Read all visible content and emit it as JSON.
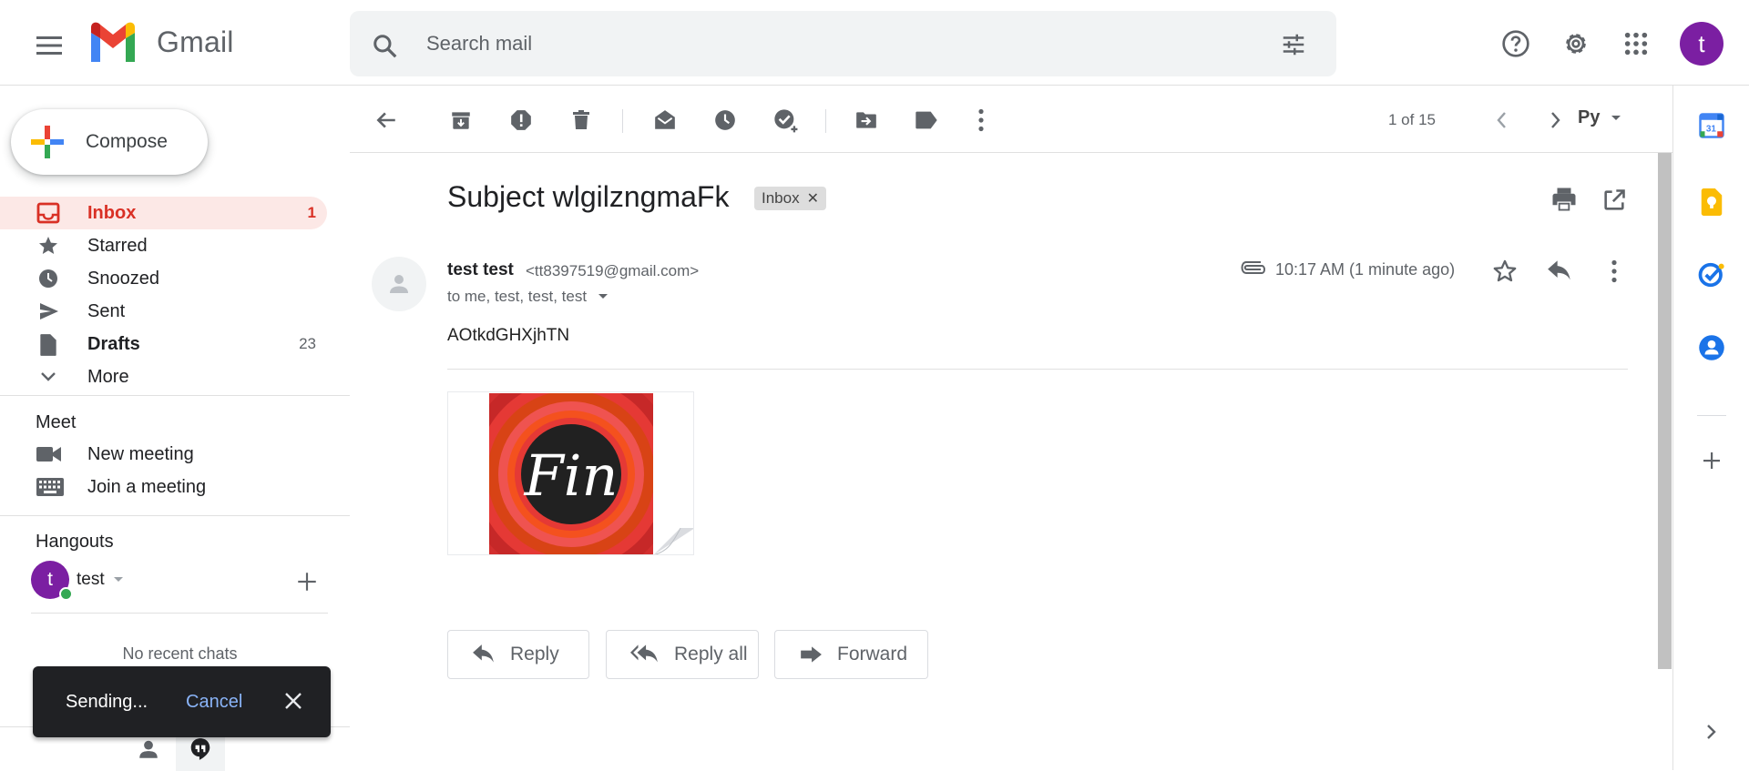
{
  "app": {
    "name": "Gmail"
  },
  "search": {
    "placeholder": "Search mail"
  },
  "account": {
    "initial": "t"
  },
  "compose": {
    "label": "Compose"
  },
  "nav": {
    "items": [
      {
        "label": "Inbox",
        "count": "1"
      },
      {
        "label": "Starred",
        "count": ""
      },
      {
        "label": "Snoozed",
        "count": ""
      },
      {
        "label": "Sent",
        "count": ""
      },
      {
        "label": "Drafts",
        "count": "23"
      },
      {
        "label": "More",
        "count": ""
      }
    ]
  },
  "meet": {
    "title": "Meet",
    "new_meeting": "New meeting",
    "join_meeting": "Join a meeting"
  },
  "hangouts": {
    "title": "Hangouts",
    "user_initial": "t",
    "user_name": "test",
    "empty": "No recent chats"
  },
  "toast": {
    "text": "Sending...",
    "action": "Cancel"
  },
  "toolbar": {
    "pager": "1 of 15",
    "language": "Py"
  },
  "email": {
    "subject": "Subject wlgilzngmaFk",
    "label": "Inbox",
    "sender_name": "test test",
    "sender_email": "<tt8397519@gmail.com>",
    "recipients": "to me, test, test, test",
    "timestamp": "10:17 AM (1 minute ago)",
    "body": "AOtkdGHXjhTN",
    "attachment_text": "Fin"
  },
  "reply_buttons": {
    "reply": "Reply",
    "reply_all": "Reply all",
    "forward": "Forward"
  },
  "colors": {
    "accent_red": "#d93025",
    "avatar_purple": "#7b1fa2",
    "active_bg": "#fce8e6",
    "toast_bg": "#202124",
    "toast_action": "#8ab4f8"
  },
  "icons": {
    "header": [
      "menu-icon",
      "gmail-logo",
      "search-icon",
      "tune-icon",
      "help-icon",
      "settings-icon",
      "apps-icon"
    ],
    "toolbar": [
      "back-icon",
      "archive-icon",
      "report-spam-icon",
      "delete-icon",
      "mark-unread-icon",
      "snooze-icon",
      "add-task-icon",
      "move-to-icon",
      "label-icon",
      "more-icon",
      "prev-icon",
      "next-icon"
    ],
    "side_panel": [
      "calendar-icon",
      "keep-icon",
      "tasks-icon",
      "contacts-icon",
      "add-addon-icon",
      "expand-panel-icon"
    ]
  }
}
